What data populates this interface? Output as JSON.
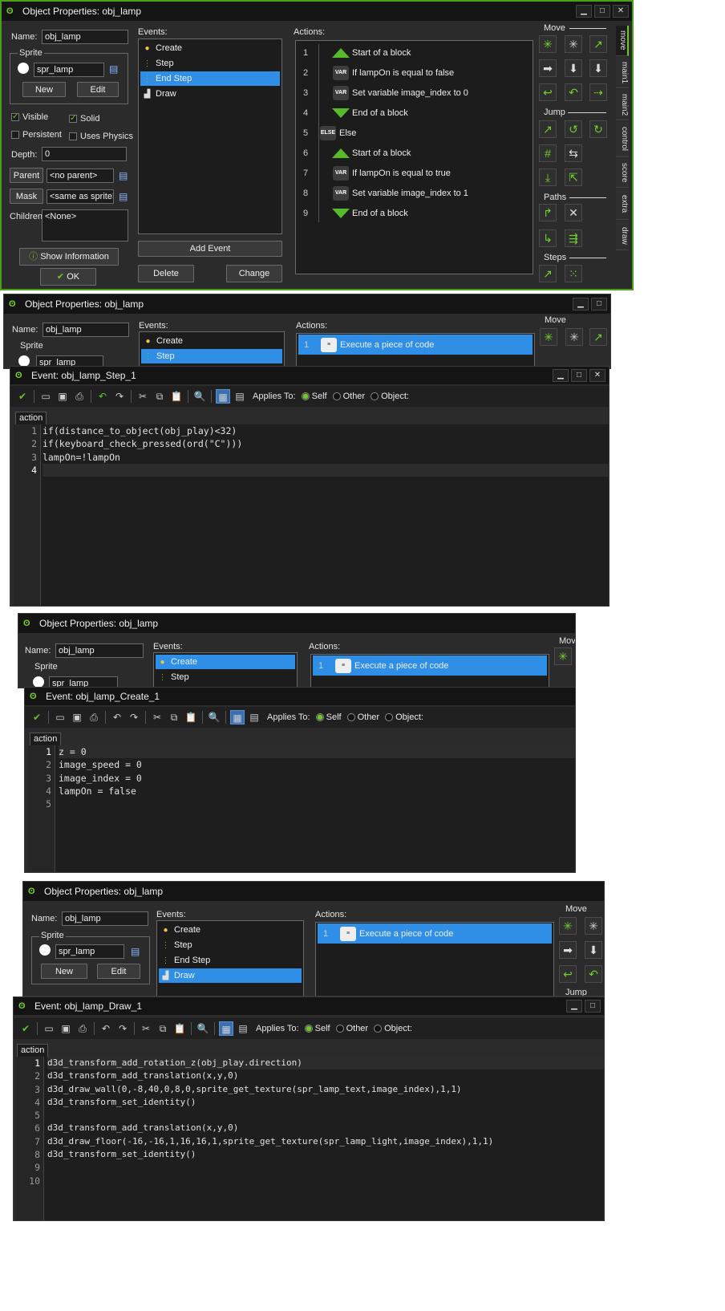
{
  "win1": {
    "title": "Object Properties: obj_lamp",
    "name_label": "Name:",
    "name_value": "obj_lamp",
    "sprite_group": "Sprite",
    "sprite_value": "spr_lamp",
    "new_label": "New",
    "edit_label": "Edit",
    "visible_label": "Visible",
    "solid_label": "Solid",
    "persistent_label": "Persistent",
    "physics_label": "Uses Physics",
    "depth_label": "Depth:",
    "depth_value": "0",
    "parent_label": "Parent",
    "parent_value": "<no parent>",
    "mask_label": "Mask",
    "mask_value": "<same as sprite>",
    "children_label": "Children:",
    "children_value": "<None>",
    "show_info_label": "Show Information",
    "ok_label": "OK",
    "events_label": "Events:",
    "events": [
      "Create",
      "Step",
      "End Step",
      "Draw"
    ],
    "add_event_label": "Add Event",
    "delete_label": "Delete",
    "change_label": "Change",
    "actions_label": "Actions:",
    "actions": [
      {
        "num": "1",
        "icon": "start-block",
        "text": "Start of a block"
      },
      {
        "num": "2",
        "icon": "var",
        "text": "If lampOn is equal to false"
      },
      {
        "num": "3",
        "icon": "var",
        "text": "Set variable image_index to 0"
      },
      {
        "num": "4",
        "icon": "end-block",
        "text": "End of a block"
      },
      {
        "num": "5",
        "icon": "else",
        "text": "Else"
      },
      {
        "num": "6",
        "icon": "start-block",
        "text": "Start of a block"
      },
      {
        "num": "7",
        "icon": "var",
        "text": "If lampOn is equal to true"
      },
      {
        "num": "8",
        "icon": "var",
        "text": "Set variable image_index to 1"
      },
      {
        "num": "9",
        "icon": "end-block",
        "text": "End of a block"
      }
    ],
    "palette": {
      "move": "Move",
      "jump": "Jump",
      "paths": "Paths",
      "steps": "Steps"
    },
    "tabs": [
      "move",
      "main1",
      "main2",
      "control",
      "score",
      "extra",
      "draw"
    ]
  },
  "win2": {
    "title": "Object Properties: obj_lamp",
    "name_label": "Name:",
    "name_value": "obj_lamp",
    "sprite_group": "Sprite",
    "sprite_value": "spr_lamp",
    "events_label": "Events:",
    "events": [
      "Create",
      "Step"
    ],
    "actions_label": "Actions:",
    "action_num": "1",
    "action_text": "Execute a piece of code",
    "palette_move": "Move"
  },
  "code1": {
    "title": "Event: obj_lamp_Step_1",
    "applies_to": "Applies To:",
    "self": "Self",
    "other": "Other",
    "object": "Object:",
    "tab": "action",
    "line_numbers": [
      "1",
      "2",
      "3",
      "4"
    ],
    "lines": [
      "if(distance_to_object(obj_play)<32)",
      "if(keyboard_check_pressed(ord(\"C\")))",
      "lampOn=!lampOn",
      ""
    ]
  },
  "win3": {
    "title": "Object Properties: obj_lamp",
    "name_label": "Name:",
    "name_value": "obj_lamp",
    "sprite_group": "Sprite",
    "sprite_value": "spr_lamp",
    "events_label": "Events:",
    "events": [
      "Create",
      "Step"
    ],
    "actions_label": "Actions:",
    "action_num": "1",
    "action_text": "Execute a piece of code",
    "palette_move": "Mov"
  },
  "code2": {
    "title": "Event: obj_lamp_Create_1",
    "applies_to": "Applies To:",
    "self": "Self",
    "other": "Other",
    "object": "Object:",
    "tab": "action",
    "line_numbers": [
      "1",
      "2",
      "3",
      "4",
      "5"
    ],
    "lines": [
      "z = 0",
      "image_speed = 0",
      "image_index = 0",
      "lampOn = false",
      ""
    ]
  },
  "win4": {
    "title": "Object Properties: obj_lamp",
    "name_label": "Name:",
    "name_value": "obj_lamp",
    "sprite_group": "Sprite",
    "sprite_value": "spr_lamp",
    "new_label": "New",
    "edit_label": "Edit",
    "events_label": "Events:",
    "events": [
      "Create",
      "Step",
      "End Step",
      "Draw"
    ],
    "actions_label": "Actions:",
    "action_num": "1",
    "action_text": "Execute a piece of code",
    "palette_move": "Move",
    "palette_jump": "Jump"
  },
  "code3": {
    "title": "Event: obj_lamp_Draw_1",
    "applies_to": "Applies To:",
    "self": "Self",
    "other": "Other",
    "object": "Object:",
    "tab": "action",
    "line_numbers": [
      "1",
      "2",
      "3",
      "4",
      "5",
      "6",
      "7",
      "8",
      "9",
      "10"
    ],
    "lines": [
      "d3d_transform_add_rotation_z(obj_play.direction)",
      "d3d_transform_add_translation(x,y,0)",
      "d3d_draw_wall(0,-8,40,0,8,0,sprite_get_texture(spr_lamp_text,image_index),1,1)",
      "d3d_transform_set_identity()",
      "",
      "d3d_transform_add_translation(x,y,0)",
      "d3d_draw_floor(-16,-16,1,16,16,1,sprite_get_texture(spr_lamp_light,image_index),1,1)",
      "d3d_transform_set_identity()",
      "",
      ""
    ]
  },
  "colors": {
    "accent_green": "#6fc52c",
    "selection_blue": "#2f8fe6",
    "window_bg": "#2b2b2b",
    "editor_bg": "#1e1e1e"
  }
}
